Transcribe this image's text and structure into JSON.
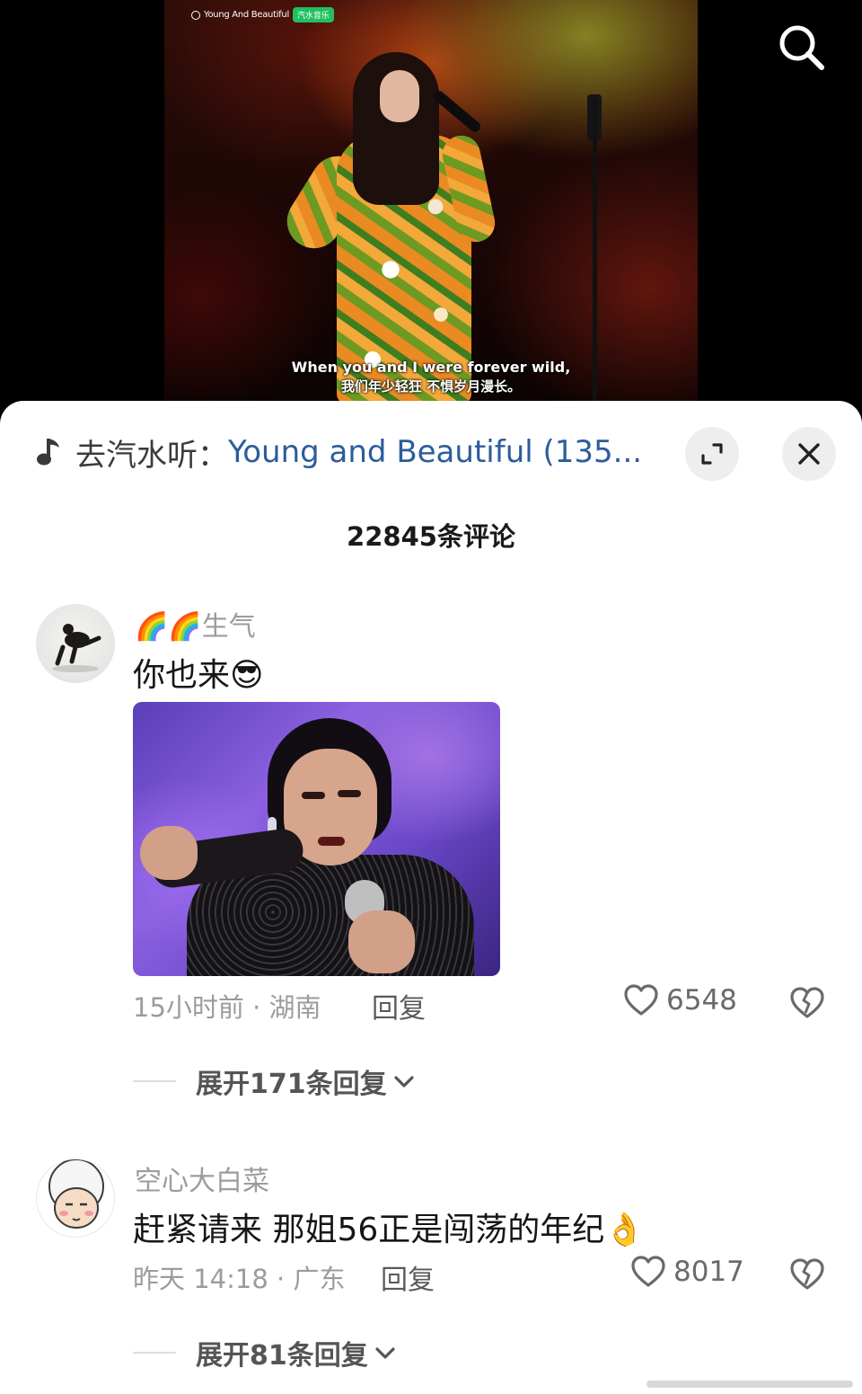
{
  "video": {
    "song_tag": "Young And Beautiful",
    "app_badge": "汽水音乐",
    "subtitle_en": "When you and I were forever wild,",
    "subtitle_zh": "我们年少轻狂 不惧岁月漫长。"
  },
  "music_bar": {
    "prefix": "去汽水听：",
    "link_text": "Young and Beautiful (135..."
  },
  "comments_header": {
    "count_text": "22845条评论"
  },
  "comments": [
    {
      "username": "🌈🌈生气",
      "text": "你也来😎",
      "time_location": "15小时前 · 湖南",
      "reply_label": "回复",
      "likes": "6548",
      "expand_label": "展开171条回复"
    },
    {
      "username": "空心大白菜",
      "text": "赶紧请来 那姐56正是闯荡的年纪👌",
      "time_location": "昨天 14:18 · 广东",
      "reply_label": "回复",
      "likes": "8017",
      "expand_label": "展开81条回复"
    }
  ],
  "icons": {
    "search": "search-icon",
    "music_note": "music-note-icon",
    "expand": "expand-icon",
    "close": "close-icon",
    "like": "heart-outline-icon",
    "dislike": "broken-heart-icon",
    "chevron": "chevron-down-icon"
  },
  "colors": {
    "link": "#2c5c9b",
    "badge": "#20c060",
    "muted": "#9c9c9c"
  }
}
